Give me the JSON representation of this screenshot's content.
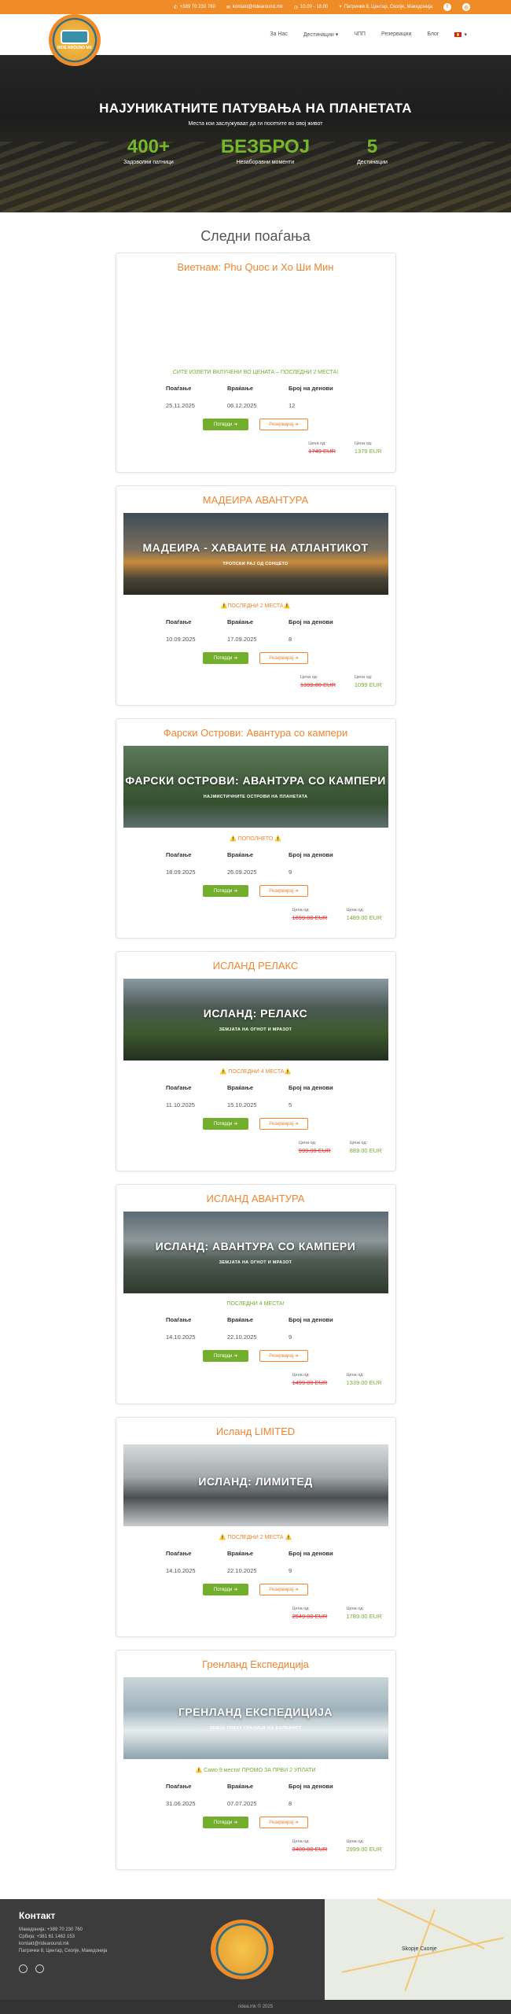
{
  "topbar": {
    "phone": "+389 70 230 760",
    "email": "kontakt@ridearound.mk",
    "hours": "10.00 - 18.00",
    "address": "Патрички 8, Центар, Скопје, Македонија"
  },
  "nav": {
    "items": [
      "За Нас",
      "Дестинации",
      "ЧПП",
      "Резервации",
      "Блог"
    ],
    "logo_text": "RIDE AROUND MK"
  },
  "hero": {
    "title": "НАЈУНИКАТНИТЕ ПАТУВАЊА НА ПЛАНЕТАТА",
    "subtitle": "Места кои заслужуваат да ги посетите во овој живот",
    "stats": [
      {
        "number": "400+",
        "label": "Задоволни патници"
      },
      {
        "number": "БЕЗБРОЈ",
        "label": "Незаборавни моменти"
      },
      {
        "number": "5",
        "label": "Дестинации"
      }
    ]
  },
  "section_title": "Следни поаѓања",
  "labels": {
    "depart": "Поаѓање",
    "return": "Враќање",
    "days": "Број на денови",
    "book": "Потврди ➜",
    "reserve": "Резервирај ➜",
    "price_from": "Цена од:",
    "price_to": "Цена од:"
  },
  "trips": [
    {
      "title": "Виетнам: Phu Quoc и Хо Ши Мин",
      "pic_title": "",
      "pic_sub": "",
      "note": "СИТЕ ИЗЛЕТИ ВКЛУЧЕНИ ВО ЦЕНАТА – ПОСЛЕДНИ 2 МЕСТА!",
      "note_color": "#74ae2f",
      "depart": "25.11.2025",
      "return": "06.12.2025",
      "days": "12",
      "old": "1749 EUR",
      "new": "1379 EUR",
      "bg": "linear-gradient(180deg,#2b3e3c 0,#6f7d55 40,#e6d79a 48%,#3c6b4a 55%,#27443c 100%)"
    },
    {
      "title": "МАДЕИРА АВАНТУРА",
      "pic_title": "МАДЕИРА - ХАВАИТЕ НА АТЛАНТИКОТ",
      "pic_sub": "ТРОПСКИ РАЈ ОД СОНЦЕТО",
      "note": "⚠️ПОСЛЕДНИ 2 МЕСТА⚠️",
      "note_color": "#ef8530",
      "depart": "10.09.2025",
      "return": "17.09.2025",
      "days": "8",
      "old": "1399.00 EUR",
      "new": "1099 EUR",
      "bg": "linear-gradient(180deg,#3e4c58 0,#7a6f5c 45%,#c98a3c 60%,#4b4536 80%,#2c2a22 100%)"
    },
    {
      "title": "Фарски Острови: Авантура со кампери",
      "pic_title": "ФАРСКИ ОСТРОВИ: АВАНТУРА СО КАМПЕРИ",
      "pic_sub": "НАЈМИСТИЧНИТЕ ОСТРОВИ НА ПЛАНЕТАТА",
      "note": "⚠️ ПОПОЛНЕТО ⚠️",
      "note_color": "#ef8530",
      "depart": "18.09.2025",
      "return": "26.09.2025",
      "days": "9",
      "old": "1699.00 EUR",
      "new": "1489.00 EUR",
      "bg": "linear-gradient(180deg,#5c7a5a 0,#45603e 40%,#35502f 70%,#5e6e70 100%)"
    },
    {
      "title": "ИСЛАНД РЕЛАКС",
      "pic_title": "ИСЛАНД: РЕЛАКС",
      "pic_sub": "ЗЕМЈАТА НА ОГНОТ И МРАЗОТ",
      "note": "⚠️ ПОСЛЕДНИ 4 МЕСТА⚠️",
      "note_color": "#ef8530",
      "depart": "11.10.2025",
      "return": "15.10.2025",
      "days": "5",
      "old": "999.00 EUR",
      "new": "889.00 EUR",
      "bg": "linear-gradient(180deg,#8a9aa2 0,#4c5a56 35%,#3d5a2f 65%,#23301f 100%)"
    },
    {
      "title": "ИСЛАНД АВАНТУРА",
      "pic_title": "ИСЛАНД: АВАНТУРА СО КАМПЕРИ",
      "pic_sub": "ЗЕМЈАТА НА ОГНОТ И МРАЗОТ",
      "note": "ПОСЛЕДНИ 4 МЕСТА!",
      "note_color": "#74ae2f",
      "depart": "14.10.2025",
      "return": "22.10.2025",
      "days": "9",
      "old": "1499.00 EUR",
      "new": "1339.00 EUR",
      "bg": "linear-gradient(180deg,#5b6a73 0,#8d969a 35%,#4f5a52 60%,#2d3a2c 100%)"
    },
    {
      "title": "Исланд LIMITED",
      "pic_title": "ИСЛАНД: ЛИМИТЕД",
      "pic_sub": "",
      "note": "⚠️ ПОСЛЕДНИ 2 МЕСТА ⚠️",
      "note_color": "#ef8530",
      "depart": "14.10.2025",
      "return": "22.10.2025",
      "days": "9",
      "old": "2549.00 EUR",
      "new": "1789.00 EUR",
      "bg": "linear-gradient(180deg,#d6dbdd 0,#a3a9ab 40%,#4a4e50 65%,#c8ccce 100%)"
    },
    {
      "title": "Гренланд Експедиција",
      "pic_title": "ГРЕНЛАНД ЕКСПЕДИЦИЈА",
      "pic_sub": "ЗЕМЈА ПРЕКУ ГРАНИЦА НА БАЛКАНОТ",
      "note": "⚠️ Само 9 места! ПРОМО ЗА ПРВИ 2 УПЛАТИ",
      "note_color": "#74ae2f",
      "depart": "31.06.2025",
      "return": "07.07.2025",
      "days": "8",
      "old": "3400.00 EUR",
      "new": "2999.00 EUR",
      "bg": "linear-gradient(180deg,#c9d5da 0,#9fb3bc 40%,#e6ecef 65%,#8da3ad 100%)"
    }
  ],
  "footer": {
    "title": "Контакт",
    "lines": [
      "Македонија: +389 70 230 760",
      "Србија: +381 61 1462 153",
      "kontakt@ridearound.mk",
      "Патрички 8, Центар, Скопје, Македонија"
    ],
    "copyright": "ridea.mk © 2025",
    "map_city": "Skopje Скопје"
  }
}
